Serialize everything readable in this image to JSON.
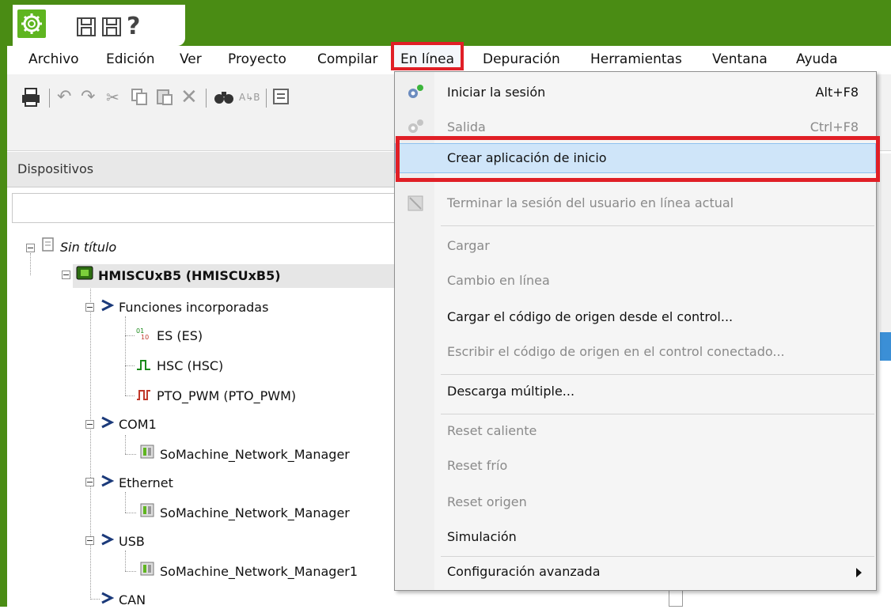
{
  "menubar": {
    "items": [
      "Archivo",
      "Edición",
      "Ver",
      "Proyecto",
      "Compilar",
      "En línea",
      "Depuración",
      "Herramientas",
      "Ventana",
      "Ayuda"
    ]
  },
  "panel": {
    "title": "Dispositivos"
  },
  "tree": {
    "items": [
      {
        "label": "Sin título"
      },
      {
        "label": "HMISCUxB5 (HMISCUxB5)"
      },
      {
        "label": "Funciones incorporadas"
      },
      {
        "label": "ES (ES)"
      },
      {
        "label": "HSC (HSC)"
      },
      {
        "label": "PTO_PWM (PTO_PWM)"
      },
      {
        "label": "COM1"
      },
      {
        "label": "SoMachine_Network_Manager"
      },
      {
        "label": "Ethernet"
      },
      {
        "label": "SoMachine_Network_Manager"
      },
      {
        "label": "USB"
      },
      {
        "label": "SoMachine_Network_Manager1"
      },
      {
        "label": "CAN"
      }
    ]
  },
  "dropdown": {
    "items": [
      {
        "label": "Iniciar la sesión",
        "shortcut": "Alt+F8",
        "enabled": true
      },
      {
        "label": "Salida",
        "shortcut": "Ctrl+F8",
        "enabled": false
      },
      {
        "label": "Crear aplicación de inicio",
        "shortcut": "",
        "enabled": true
      },
      {
        "label": "Terminar la sesión del usuario en línea actual",
        "shortcut": "",
        "enabled": false
      },
      {
        "label": "Cargar",
        "shortcut": "",
        "enabled": false
      },
      {
        "label": "Cambio en línea",
        "shortcut": "",
        "enabled": false
      },
      {
        "label": "Cargar el código de origen desde el control...",
        "shortcut": "",
        "enabled": true
      },
      {
        "label": "Escribir el código de origen en el control conectado...",
        "shortcut": "",
        "enabled": false
      },
      {
        "label": "Descarga múltiple...",
        "shortcut": "",
        "enabled": true
      },
      {
        "label": "Reset caliente",
        "shortcut": "",
        "enabled": false
      },
      {
        "label": "Reset frío",
        "shortcut": "",
        "enabled": false
      },
      {
        "label": "Reset origen",
        "shortcut": "",
        "enabled": false
      },
      {
        "label": "Simulación",
        "shortcut": "",
        "enabled": true
      },
      {
        "label": "Configuración avanzada",
        "shortcut": "",
        "enabled": true
      }
    ]
  },
  "colors": {
    "titlebar": "#4a8c14",
    "highlight_red": "#e01f26",
    "menu_highlight": "#cfe5f9"
  }
}
